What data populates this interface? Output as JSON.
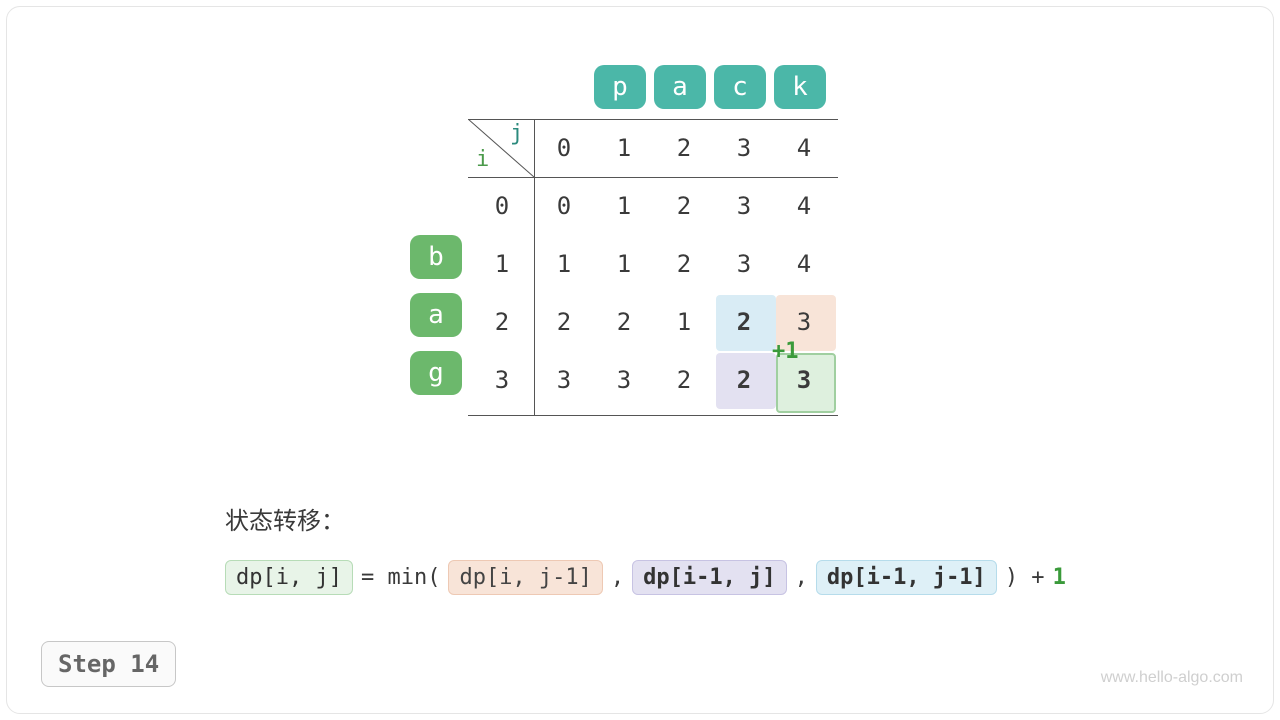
{
  "step_label": "Step 14",
  "watermark": "www.hello-algo.com",
  "target": {
    "chars": [
      "p",
      "a",
      "c",
      "k"
    ],
    "color": "teal"
  },
  "source": {
    "chars": [
      "b",
      "a",
      "g"
    ],
    "color": "green"
  },
  "axes": {
    "row_label": "i",
    "col_label": "j"
  },
  "col_indices": [
    "0",
    "1",
    "2",
    "3",
    "4"
  ],
  "row_indices": [
    "0",
    "1",
    "2",
    "3"
  ],
  "dp": [
    [
      "0",
      "1",
      "2",
      "3",
      "4"
    ],
    [
      "1",
      "1",
      "2",
      "3",
      "4"
    ],
    [
      "2",
      "2",
      "1",
      "2",
      "3"
    ],
    [
      "3",
      "3",
      "2",
      "2",
      "3"
    ]
  ],
  "bold_cells": [
    [
      2,
      3
    ],
    [
      2,
      4
    ],
    [
      3,
      3
    ],
    [
      3,
      4
    ]
  ],
  "highlights": {
    "blue": {
      "row": 2,
      "col": 3
    },
    "orange": {
      "row": 2,
      "col": 4
    },
    "purple": {
      "row": 3,
      "col": 3
    },
    "green": {
      "row": 3,
      "col": 4
    }
  },
  "annotation": {
    "text": "+1",
    "between_rows": [
      2,
      3
    ],
    "col": 4
  },
  "formula": {
    "title": "状态转移：",
    "lhs": "dp[i, j]",
    "eq": " = min( ",
    "t1": "dp[i, j-1]",
    "c1": " , ",
    "t2": "dp[i-1, j]",
    "c2": " , ",
    "t3": "dp[i-1, j-1]",
    "tail": " ) + ",
    "one": "1"
  },
  "chart_data": {
    "type": "table",
    "description": "Edit-distance DP table, source 'bag' → target 'pack', step 14 (computing dp[3][4])",
    "source_string": "bag",
    "target_string": "pack",
    "row_headers": [
      0,
      1,
      2,
      3
    ],
    "col_headers": [
      0,
      1,
      2,
      3,
      4
    ],
    "values": [
      [
        0,
        1,
        2,
        3,
        4
      ],
      [
        1,
        1,
        2,
        3,
        4
      ],
      [
        2,
        2,
        1,
        2,
        3
      ],
      [
        3,
        3,
        2,
        2,
        3
      ]
    ],
    "current_cell": {
      "i": 3,
      "j": 4,
      "value": 3
    },
    "dependencies": {
      "dp[i,j-1]": {
        "i": 3,
        "j": 3,
        "value": 2
      },
      "dp[i-1,j]": {
        "i": 2,
        "j": 4,
        "value": 3
      },
      "dp[i-1,j-1]": {
        "i": 2,
        "j": 3,
        "value": 2
      }
    },
    "transition": "dp[i,j] = min(dp[i,j-1], dp[i-1,j], dp[i-1,j-1]) + 1"
  }
}
